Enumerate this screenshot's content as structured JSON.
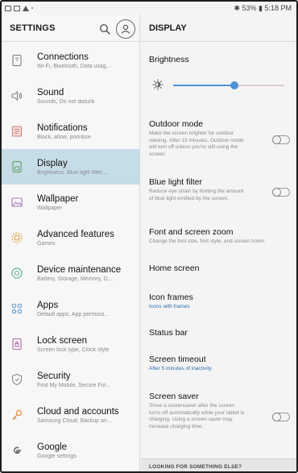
{
  "status_bar": {
    "right_text": "✱ 53% ▮ 5:18 PM"
  },
  "left_pane": {
    "title": "SETTINGS",
    "items": [
      {
        "label": "Connections",
        "sub": "Wi-Fi, Bluetooth, Data usag...",
        "icon": "connections-icon"
      },
      {
        "label": "Sound",
        "sub": "Sounds, Do not disturb",
        "icon": "sound-icon"
      },
      {
        "label": "Notifications",
        "sub": "Block, allow, prioritize",
        "icon": "notifications-icon"
      },
      {
        "label": "Display",
        "sub": "Brightness, Blue light filter,...",
        "icon": "display-icon",
        "active": true
      },
      {
        "label": "Wallpaper",
        "sub": "Wallpaper",
        "icon": "wallpaper-icon"
      },
      {
        "label": "Advanced features",
        "sub": "Games",
        "icon": "advanced-features-icon"
      },
      {
        "label": "Device maintenance",
        "sub": "Battery, Storage, Memory, D...",
        "icon": "device-maintenance-icon"
      },
      {
        "label": "Apps",
        "sub": "Default apps, App permissi...",
        "icon": "apps-icon"
      },
      {
        "label": "Lock screen",
        "sub": "Screen lock type, Clock style",
        "icon": "lock-screen-icon"
      },
      {
        "label": "Security",
        "sub": "Find My Mobile, Secure Fol...",
        "icon": "security-icon"
      },
      {
        "label": "Cloud and accounts",
        "sub": "Samsung Cloud, Backup an...",
        "icon": "cloud-accounts-icon"
      },
      {
        "label": "Google",
        "sub": "Google settings",
        "icon": "google-icon"
      }
    ]
  },
  "right_pane": {
    "title": "DISPLAY",
    "brightness": {
      "label": "Brightness",
      "level": 0.55
    },
    "outdoor_mode": {
      "label": "Outdoor mode",
      "sub": "Make the screen brighter for outdoor viewing. After 15 minutes, Outdoor mode will turn off unless you're still using the screen.",
      "enabled": false
    },
    "blue_light_filter": {
      "label": "Blue light filter",
      "sub": "Reduce eye strain by limiting the amount of blue light emitted by the screen.",
      "enabled": false
    },
    "font_zoom": {
      "label": "Font and screen zoom",
      "sub": "Change the font size, font style, and screen zoom."
    },
    "home_screen": {
      "label": "Home screen"
    },
    "icon_frames": {
      "label": "Icon frames",
      "sub": "Icons with frames"
    },
    "status_bar": {
      "label": "Status bar"
    },
    "screen_timeout": {
      "label": "Screen timeout",
      "sub": "After 5 minutes of inactivity."
    },
    "screen_saver": {
      "label": "Screen saver",
      "sub": "Show a screensaver after the screen turns off automatically while your tablet is charging. Using a screen saver may increase charging time.",
      "enabled": false
    },
    "footer": "LOOKING FOR SOMETHING ELSE?"
  },
  "colors": {
    "accent": "#4f93d6",
    "active_row": "#c6dde8",
    "link_text": "#2b6fb0"
  }
}
